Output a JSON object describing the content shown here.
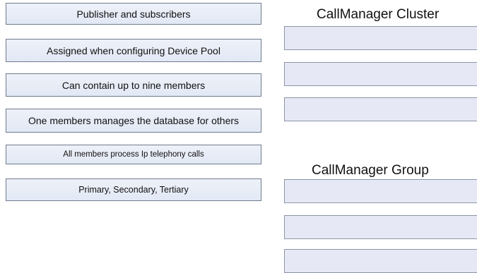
{
  "source_items": [
    "Publisher and subscribers",
    "Assigned when configuring Device Pool",
    "Can contain up to nine members",
    "One members manages the database for others",
    "All members process Ip telephony calls",
    "Primary, Secondary, Tertiary"
  ],
  "targets": {
    "cluster": {
      "title": "CallManager Cluster",
      "slots": [
        "",
        "",
        ""
      ]
    },
    "group": {
      "title": "CallManager Group",
      "slots": [
        "",
        "",
        ""
      ]
    }
  },
  "colors": {
    "item_fill": "#e2e8f5",
    "item_border": "#6f7b8e",
    "slot_fill": "#e6e9f5",
    "slot_border": "#8b95a6"
  }
}
